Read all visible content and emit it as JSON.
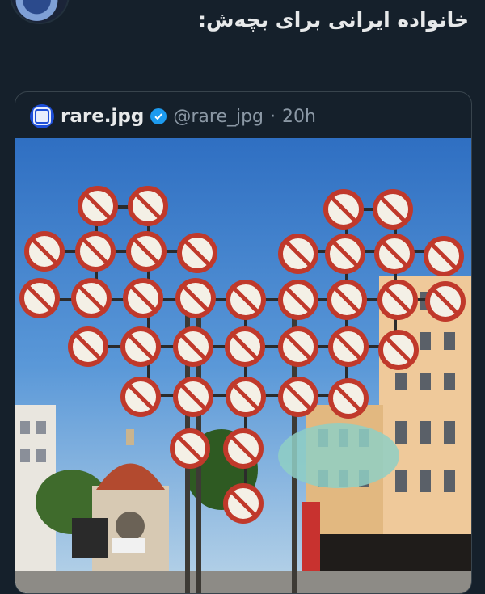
{
  "tweet": {
    "text": "خانواده ایرانی برای بچه‌ش:"
  },
  "quoted_tweet": {
    "display_name": "rare.jpg",
    "handle": "@rare_jpg",
    "separator": "·",
    "time": "20h"
  },
  "media": {
    "description_icon": "no-signs-photo"
  }
}
